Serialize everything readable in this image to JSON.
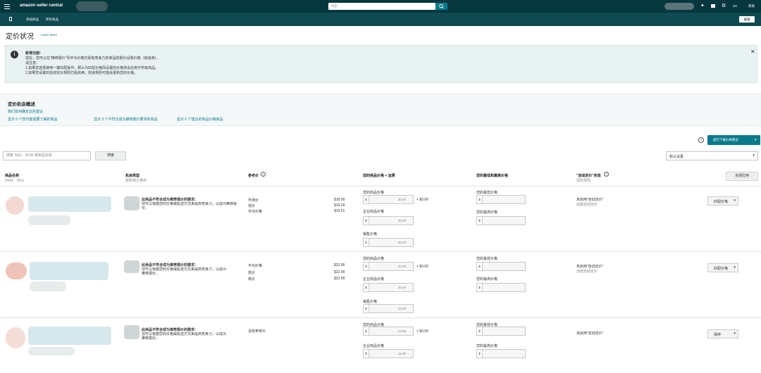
{
  "topbar": {
    "brand": "amazon seller central",
    "search_placeholder": "搜索",
    "lang": "ZH",
    "help": "帮助"
  },
  "subnav": {
    "items": [
      "添加商品",
      "所有商品"
    ],
    "right_label": "编辑"
  },
  "page": {
    "title": "定价状况",
    "learn_more": "Learn More"
  },
  "notice": {
    "title": "新增功能!",
    "line1": "现在，您可以在\"推荐报价\"列中为价格已经有竞争力的商品的报价设置价格（如适用）。",
    "line2": "请注意：",
    "line3": "1.如果您选择使用一键匹配操作，那么为匹配价格而设置的价格将会应用于所有商品。",
    "line4": "2.如果您设置的自动定价规则已经启用，则该规则可能会更新您的价格。"
  },
  "overview": {
    "title": "定价机会概述",
    "subtitle": "我们如何确定这些建议",
    "filter1": "显示 0 个您可能需要了解的商品",
    "filter2": "显示 3 个不符合成为推荐报价要求的商品",
    "filter3": "显示 0 个建议的商品价格商品"
  },
  "toolbar": {
    "search_placeholder": "搜索 SKU、ASIN 或商品名称",
    "search_button": "搜索",
    "download_button": "提示下载价格建议",
    "sort_select": "默认设置"
  },
  "table": {
    "headers": {
      "product": "商品名称",
      "product_sub": "ASIN、SKU",
      "opportunity": "机会类型",
      "opportunity_sub": "按影响力排序",
      "reference": "参考价",
      "your_price": "您的商品价格 + 运费",
      "min_max": "您的最低和最高价格",
      "automate": "\"自动定价\"状态",
      "automate_sub": "您的规则",
      "apply_all": "全部应用"
    },
    "rows": [
      {
        "opp_title": "此商品不符合成为推荐报价的要求：",
        "opp_text": "您可以根据您的价格或配送方式来提高竞争力，以成为推荐报价。",
        "ref_labels": [
          "市场价",
          "低价",
          "平均价格"
        ],
        "ref_values": [
          "$18.99",
          "$19.29",
          "$19.51"
        ],
        "price_label": "您的商品价格",
        "price": "35.00",
        "shipping": "+ $0.00",
        "business_label": "企业商品价格",
        "business": "25.00",
        "min_label": "您的最低价格",
        "max_label": "您的最高价格",
        "automate_status": "未启用\"自动定价\"",
        "automate_link": "创建自动定价",
        "action": "匹配价格",
        "extra_label": "销售价格",
        "extra_price": "25.00"
      },
      {
        "opp_title": "此商品不符合成为推荐报价的要求：",
        "opp_text": "您可以根据您的价格或配送方式来提高竞争力，以成为推荐报价。",
        "ref_labels": [
          "平均价格",
          "低价",
          "高价"
        ],
        "ref_values": [
          "$22.95",
          "$22.99",
          "$23.99"
        ],
        "price_label": "您的商品价格",
        "price": "25.99",
        "shipping": "+ $0.00",
        "business_label": "企业商品价格",
        "business": "25.00",
        "min_label": "您的最低价格",
        "max_label": "您的最高价格",
        "automate_status": "未启用\"自动定价\"",
        "automate_link": "创建自动定价",
        "action": "匹配价格",
        "extra_label": "销售价格",
        "extra_price": "23.00"
      },
      {
        "opp_title": "此商品不符合成为推荐报价的要求：",
        "opp_text": "您可以根据您的价格或配送方式来提高竞争力，以成为推荐报价。",
        "ref_labels": [
          "没有参考价"
        ],
        "ref_values": [],
        "price_label": "您的商品价格",
        "price": "14.99",
        "shipping": "+ $0.00",
        "business_label": "企业商品价格",
        "business": "11.99",
        "min_label": "您的最低价格",
        "max_label": "您的最高价格",
        "automate_status": "未启用\"自动定价\"",
        "automate_link": "",
        "action": "保存"
      }
    ]
  }
}
